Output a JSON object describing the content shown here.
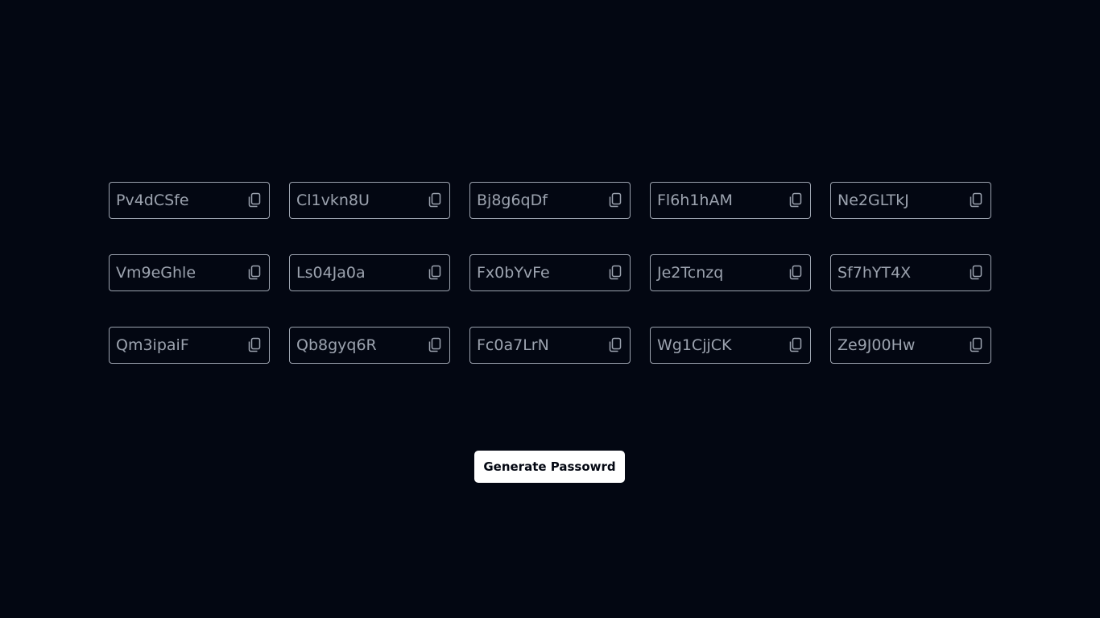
{
  "passwords": [
    "Pv4dCSfe",
    "Cl1vkn8U",
    "Bj8g6qDf",
    "Fl6h1hAM",
    "Ne2GLTkJ",
    "Vm9eGhle",
    "Ls04Ja0a",
    "Fx0bYvFe",
    "Je2Tcnzq",
    "Sf7hYT4X",
    "Qm3ipaiF",
    "Qb8gyq6R",
    "Fc0a7LrN",
    "Wg1CjjCK",
    "Ze9J00Hw"
  ],
  "copy_icon": "copy-icon",
  "generate_button": {
    "label": "Generate Passowrd"
  },
  "colors": {
    "background": "#030712",
    "text_muted": "#9ca3af",
    "button_bg": "#ffffff"
  }
}
